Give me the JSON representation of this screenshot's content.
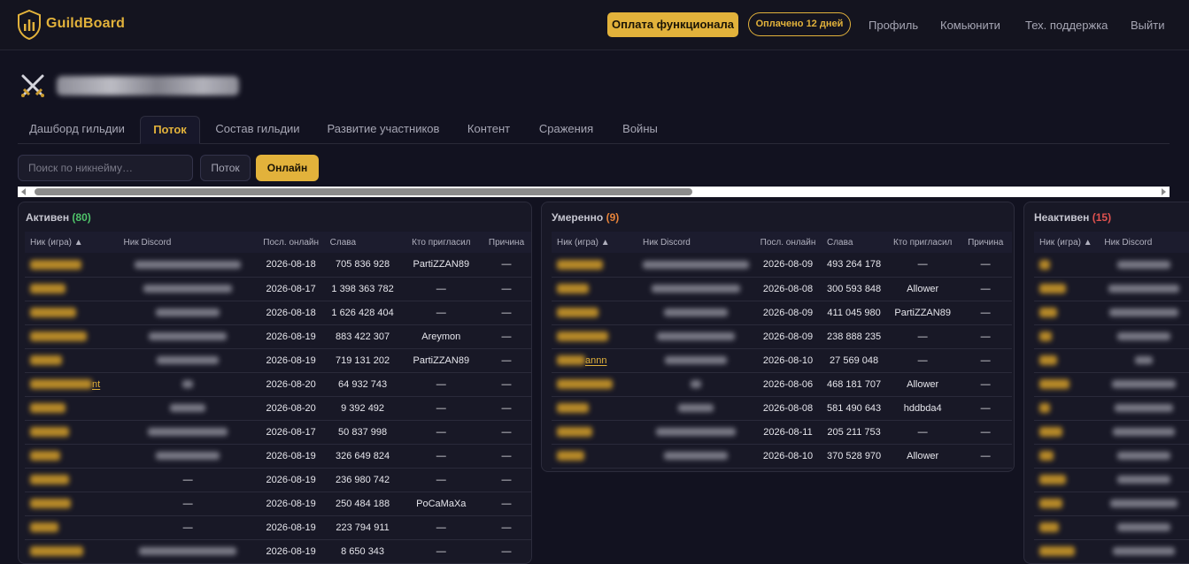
{
  "header": {
    "brand": "GuildBoard",
    "pay_button": "Оплата функционала",
    "paid_badge": "Оплачено 12 дней",
    "nav": [
      "Профиль",
      "Комьюнити",
      "Тех. поддержка",
      "Выйти"
    ]
  },
  "tabs": [
    "Дашборд гильдии",
    "Поток",
    "Состав гильдии",
    "Развитие участников",
    "Контент",
    "Сражения",
    "Войны"
  ],
  "active_tab": "Поток",
  "filters": {
    "search_placeholder": "Поиск по никнейму…",
    "flow_button": "Поток",
    "online_button": "Онлайн"
  },
  "columns": [
    "Ник (игра) ▲",
    "Ник Discord",
    "Посл. онлайн",
    "Слава",
    "Кто пригласил",
    "Причина"
  ],
  "panels": {
    "active": {
      "title": "Активен",
      "count": "(80)",
      "rows": [
        {
          "nick_suffix": "",
          "discord": "",
          "last_online": "2026-08-18",
          "fame": "705 836 928",
          "invited_by": "PartiZZAN89",
          "reason": "—"
        },
        {
          "nick_suffix": "",
          "discord": "",
          "last_online": "2026-08-17",
          "fame": "1 398 363 782",
          "invited_by": "—",
          "reason": "—"
        },
        {
          "nick_suffix": "",
          "discord": "",
          "last_online": "2026-08-18",
          "fame": "1 626 428 404",
          "invited_by": "—",
          "reason": "—"
        },
        {
          "nick_suffix": "",
          "discord": "",
          "last_online": "2026-08-19",
          "fame": "883 422 307",
          "invited_by": "Areymon",
          "reason": "—"
        },
        {
          "nick_suffix": "",
          "discord": "",
          "last_online": "2026-08-19",
          "fame": "719 131 202",
          "invited_by": "PartiZZAN89",
          "reason": "—"
        },
        {
          "nick_suffix": "nt",
          "discord": "",
          "last_online": "2026-08-20",
          "fame": "64 932 743",
          "invited_by": "—",
          "reason": "—"
        },
        {
          "nick_suffix": "",
          "discord": "",
          "last_online": "2026-08-20",
          "fame": "9 392 492",
          "invited_by": "—",
          "reason": "—"
        },
        {
          "nick_suffix": "",
          "discord": "",
          "last_online": "2026-08-17",
          "fame": "50 837 998",
          "invited_by": "—",
          "reason": "—"
        },
        {
          "nick_suffix": "",
          "discord": "",
          "last_online": "2026-08-19",
          "fame": "326 649 824",
          "invited_by": "—",
          "reason": "—"
        },
        {
          "nick_suffix": "",
          "discord": "—",
          "last_online": "2026-08-19",
          "fame": "236 980 742",
          "invited_by": "—",
          "reason": "—"
        },
        {
          "nick_suffix": "",
          "discord": "—",
          "last_online": "2026-08-19",
          "fame": "250 484 188",
          "invited_by": "PoCaMaXa",
          "reason": "—"
        },
        {
          "nick_suffix": "",
          "discord": "—",
          "last_online": "2026-08-19",
          "fame": "223 794 911",
          "invited_by": "—",
          "reason": "—"
        },
        {
          "nick_suffix": "",
          "discord": "",
          "last_online": "2026-08-19",
          "fame": "8 650 343",
          "invited_by": "—",
          "reason": "—"
        }
      ]
    },
    "moderate": {
      "title": "Умеренно",
      "count": "(9)",
      "rows": [
        {
          "nick_suffix": "",
          "discord": "",
          "last_online": "2026-08-09",
          "fame": "493 264 178",
          "invited_by": "—",
          "reason": "—"
        },
        {
          "nick_suffix": "",
          "discord": "",
          "last_online": "2026-08-08",
          "fame": "300 593 848",
          "invited_by": "Allower",
          "reason": "—"
        },
        {
          "nick_suffix": "",
          "discord": "",
          "last_online": "2026-08-09",
          "fame": "411 045 980",
          "invited_by": "PartiZZAN89",
          "reason": "—"
        },
        {
          "nick_suffix": "",
          "discord": "",
          "last_online": "2026-08-09",
          "fame": "238 888 235",
          "invited_by": "—",
          "reason": "—"
        },
        {
          "nick_suffix": "annn",
          "discord": "",
          "last_online": "2026-08-10",
          "fame": "27 569 048",
          "invited_by": "—",
          "reason": "—"
        },
        {
          "nick_suffix": "",
          "discord": "",
          "last_online": "2026-08-06",
          "fame": "468 181 707",
          "invited_by": "Allower",
          "reason": "—"
        },
        {
          "nick_suffix": "",
          "discord": "",
          "last_online": "2026-08-08",
          "fame": "581 490 643",
          "invited_by": "hddbda4",
          "reason": "—"
        },
        {
          "nick_suffix": "",
          "discord": "",
          "last_online": "2026-08-11",
          "fame": "205 211 753",
          "invited_by": "—",
          "reason": "—"
        },
        {
          "nick_suffix": "",
          "discord": "",
          "last_online": "2026-08-10",
          "fame": "370 528 970",
          "invited_by": "Allower",
          "reason": "—"
        }
      ]
    },
    "inactive": {
      "title": "Неактивен",
      "count": "(15)"
    }
  },
  "colors": {
    "accent": "#e2b23b",
    "active": "#4fc46a",
    "moderate": "#e6833a",
    "inactive": "#e0524f"
  }
}
